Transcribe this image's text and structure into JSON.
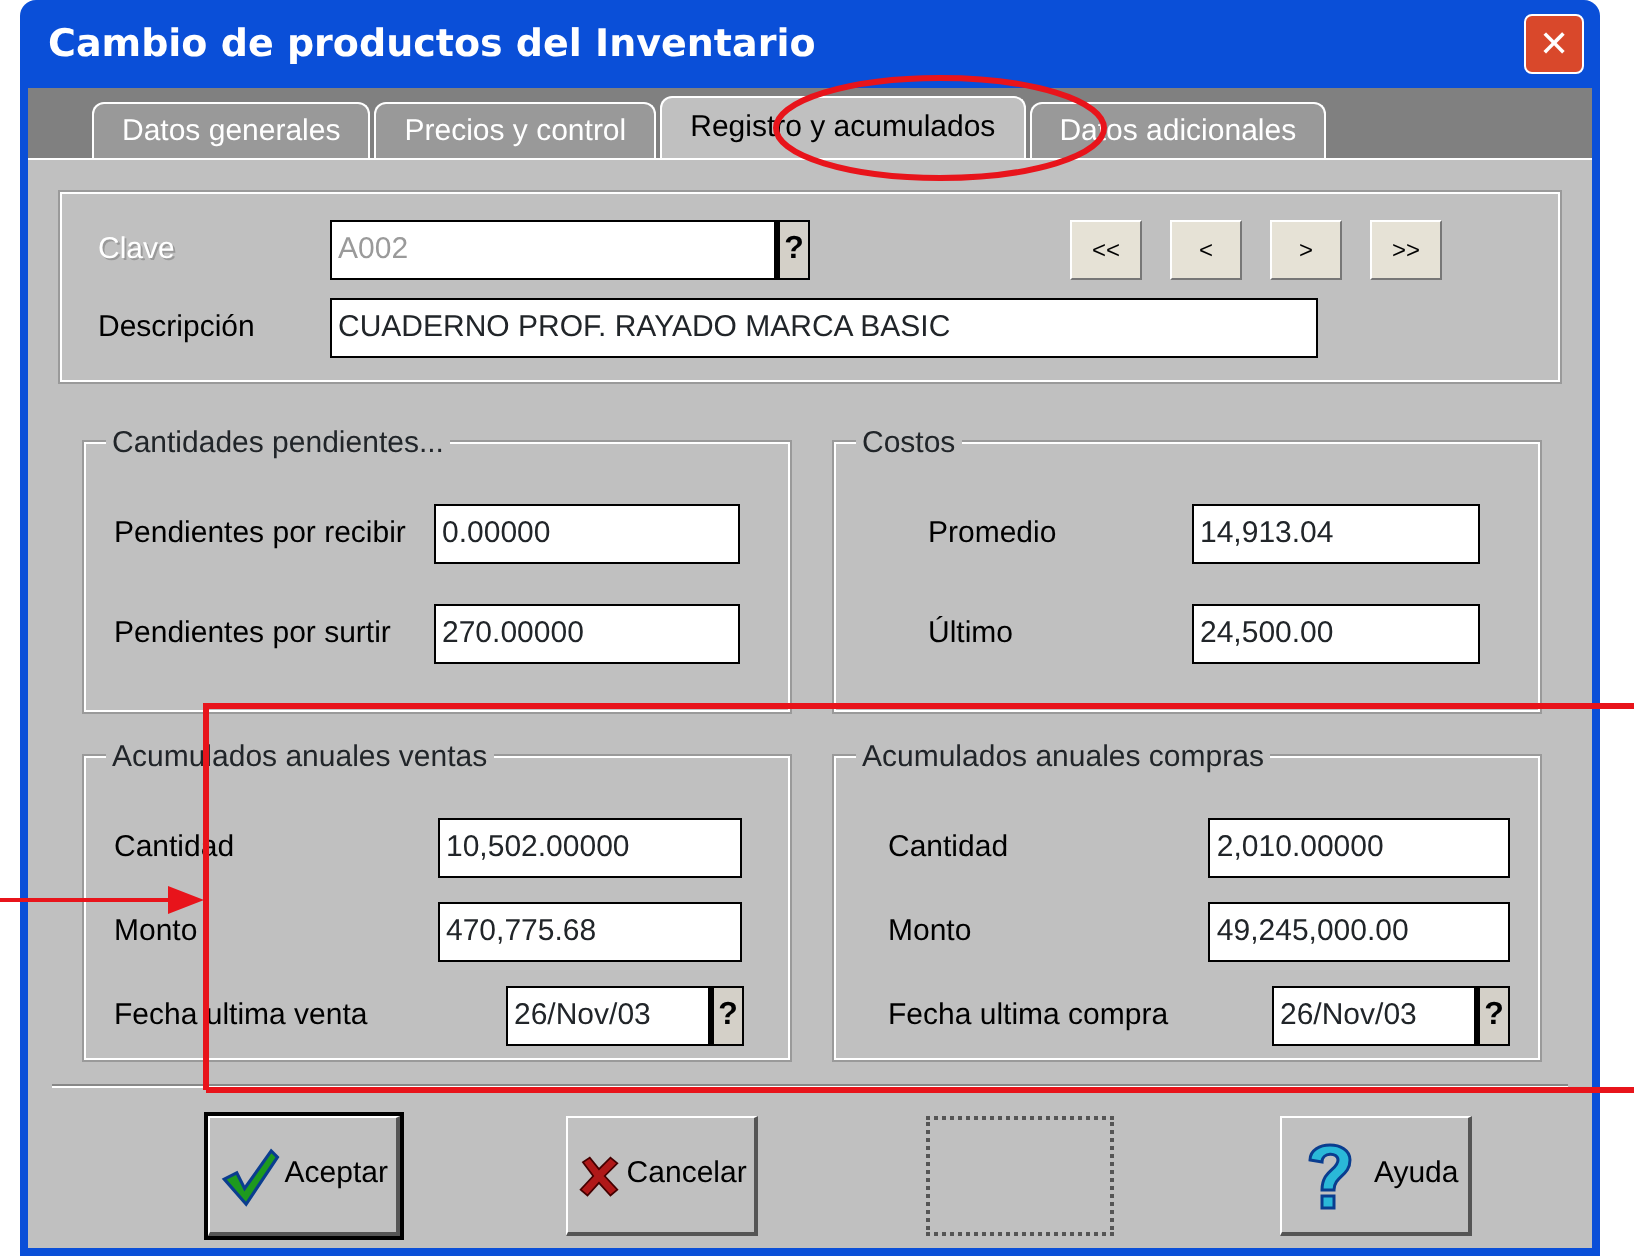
{
  "window": {
    "title": "Cambio de productos del Inventario",
    "close": "✕"
  },
  "tabs": [
    {
      "label": "Datos generales",
      "selected": false
    },
    {
      "label": "Precios y control",
      "selected": false
    },
    {
      "label": "Registro y acumulados",
      "selected": true
    },
    {
      "label": "Datos adicionales",
      "selected": false
    }
  ],
  "header": {
    "clave": {
      "label": "Clave",
      "value": "A002",
      "disabled": true,
      "lookup_button": "?"
    },
    "nav_buttons": [
      "<<",
      "<",
      ">",
      ">>"
    ],
    "descripcion": {
      "label": "Descripción",
      "value": "CUADERNO PROF. RAYADO MARCA BASIC"
    }
  },
  "groups": [
    {
      "title": "Cantidades pendientes...",
      "fields": [
        {
          "label": "Pendientes por recibir",
          "value": "0.00000"
        },
        {
          "label": "Pendientes por surtir",
          "value": "270.00000"
        }
      ]
    },
    {
      "title": "Costos",
      "fields": [
        {
          "label": "Promedio",
          "value": "14,913.04"
        },
        {
          "label": "Último",
          "value": "24,500.00"
        }
      ]
    },
    {
      "title": "Acumulados anuales ventas",
      "fields": [
        {
          "label": "Cantidad",
          "value": "10,502.00000"
        },
        {
          "label": "Monto",
          "value": "470,775.68"
        },
        {
          "label": "Fecha ultima venta",
          "value": "26/Nov/03",
          "lookup_button": "?"
        }
      ]
    },
    {
      "title": "Acumulados anuales compras",
      "fields": [
        {
          "label": "Cantidad",
          "value": "2,010.00000"
        },
        {
          "label": "Monto",
          "value": "49,245,000.00"
        },
        {
          "label": "Fecha ultima compra",
          "value": "26/Nov/03",
          "lookup_button": "?"
        }
      ]
    }
  ],
  "buttons": [
    {
      "kind": "accept",
      "label": "Aceptar",
      "default": true,
      "disabled": false
    },
    {
      "kind": "cancel",
      "label": "Cancelar",
      "default": false,
      "disabled": false
    },
    {
      "kind": "blank",
      "default": false,
      "disabled": true
    },
    {
      "kind": "help",
      "label": "Ayuda",
      "default": false,
      "disabled": false
    }
  ],
  "annotations": [
    {
      "kind": "ellipse"
    },
    {
      "kind": "frame"
    },
    {
      "kind": "arrow"
    }
  ]
}
